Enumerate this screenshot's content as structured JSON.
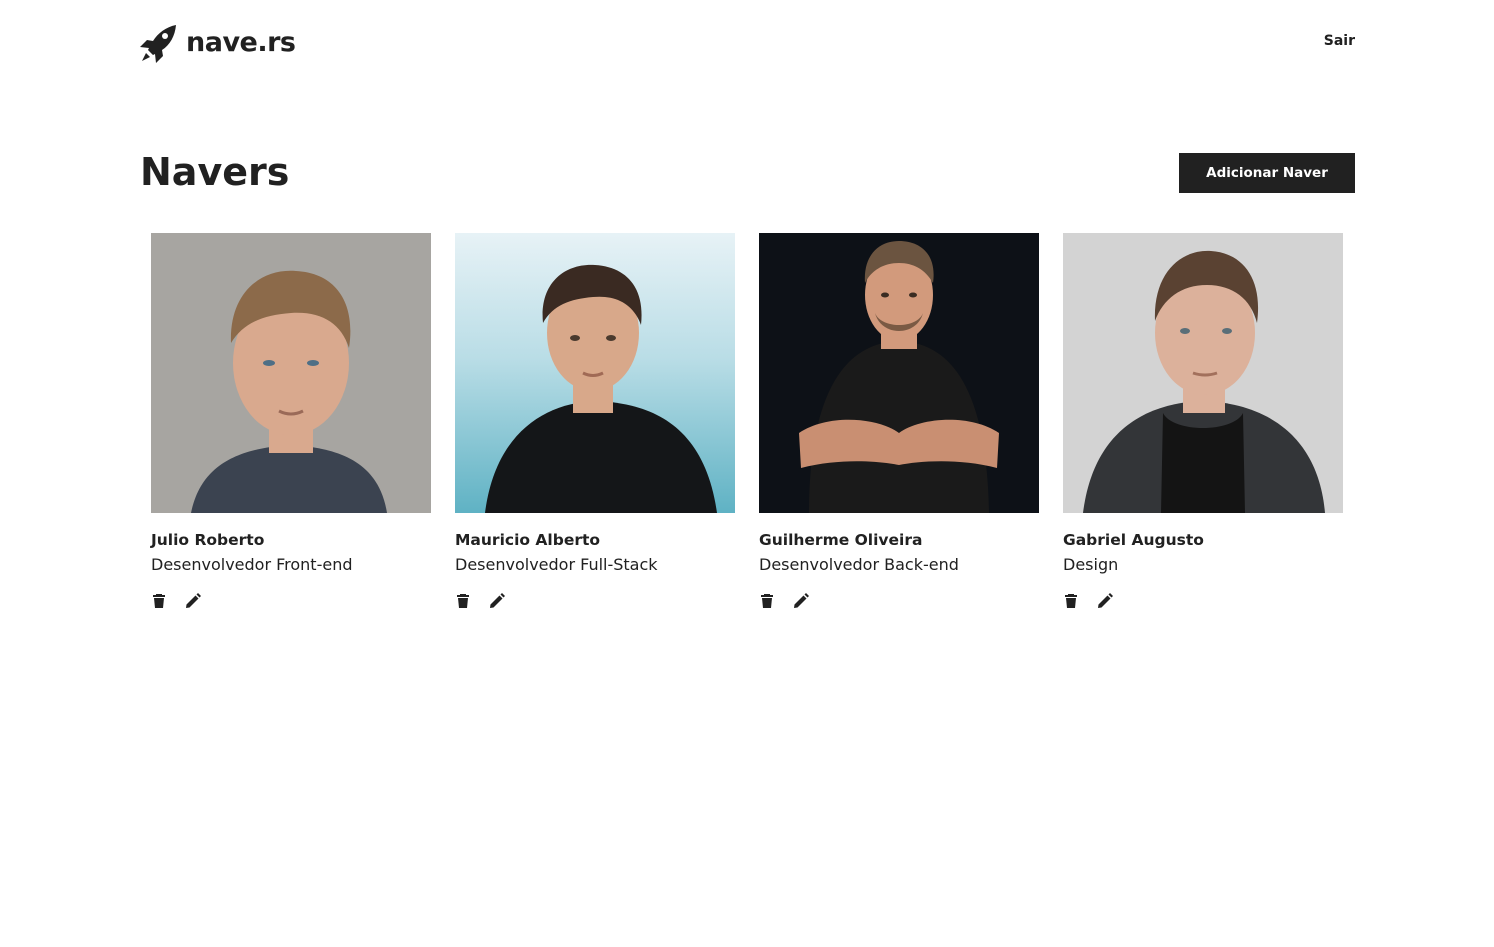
{
  "header": {
    "brand": "nave.rs",
    "logout_label": "Sair"
  },
  "main": {
    "title": "Navers",
    "add_button_label": "Adicionar Naver"
  },
  "navers": [
    {
      "name": "Julio Roberto",
      "job_role": "Desenvolvedor Front-end",
      "photo": {
        "background": "#a7a5a1",
        "shirt": "#3b4350",
        "hair": "#8c6a4a",
        "skin": "#d9a98e"
      }
    },
    {
      "name": "Mauricio Alberto",
      "job_role": "Desenvolvedor Full-Stack",
      "photo": {
        "background": "#8fcbd6",
        "shirt": "#141618",
        "hair": "#3a2a22",
        "skin": "#d8a88a"
      }
    },
    {
      "name": "Guilherme Oliveira",
      "job_role": "Desenvolvedor Back-end",
      "photo": {
        "background": "#0d1117",
        "shirt": "#1a1a1a",
        "hair": "#6b5440",
        "skin": "#d29a7c"
      }
    },
    {
      "name": "Gabriel Augusto",
      "job_role": "Design",
      "photo": {
        "background": "#d3d3d3",
        "shirt": "#333538",
        "hair": "#5a4232",
        "skin": "#dcb19b"
      }
    }
  ],
  "icons": {
    "brand_logo": "rocket-icon",
    "delete": "trash-icon",
    "edit": "pencil-icon"
  },
  "colors": {
    "primary": "#212121",
    "background": "#ffffff"
  }
}
